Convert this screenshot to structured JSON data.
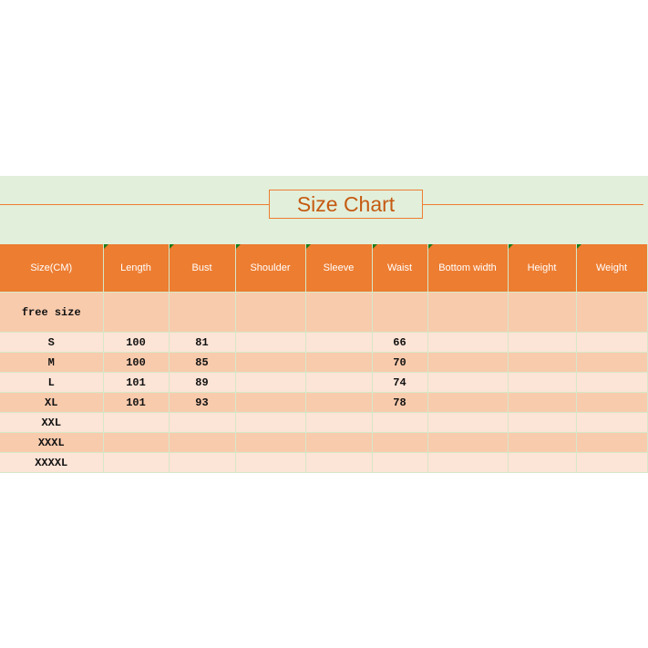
{
  "title": "Size Chart",
  "colors": {
    "header": "#ED7D31",
    "band": "#E2EFDA",
    "row_dark": "#F8CBAD",
    "row_light": "#FCE4D6"
  },
  "columns": [
    "Size(CM)",
    "Length",
    "Bust",
    "Shoulder",
    "Sleeve",
    "Waist",
    "Bottom width",
    "Height",
    "Weight"
  ],
  "rows": [
    [
      "free size",
      "",
      "",
      "",
      "",
      "",
      "",
      "",
      ""
    ],
    [
      "S",
      "100",
      "81",
      "",
      "",
      "66",
      "",
      "",
      ""
    ],
    [
      "M",
      "100",
      "85",
      "",
      "",
      "70",
      "",
      "",
      ""
    ],
    [
      "L",
      "101",
      "89",
      "",
      "",
      "74",
      "",
      "",
      ""
    ],
    [
      "XL",
      "101",
      "93",
      "",
      "",
      "78",
      "",
      "",
      ""
    ],
    [
      "XXL",
      "",
      "",
      "",
      "",
      "",
      "",
      "",
      ""
    ],
    [
      "XXXL",
      "",
      "",
      "",
      "",
      "",
      "",
      "",
      ""
    ],
    [
      "XXXXL",
      "",
      "",
      "",
      "",
      "",
      "",
      "",
      ""
    ]
  ]
}
